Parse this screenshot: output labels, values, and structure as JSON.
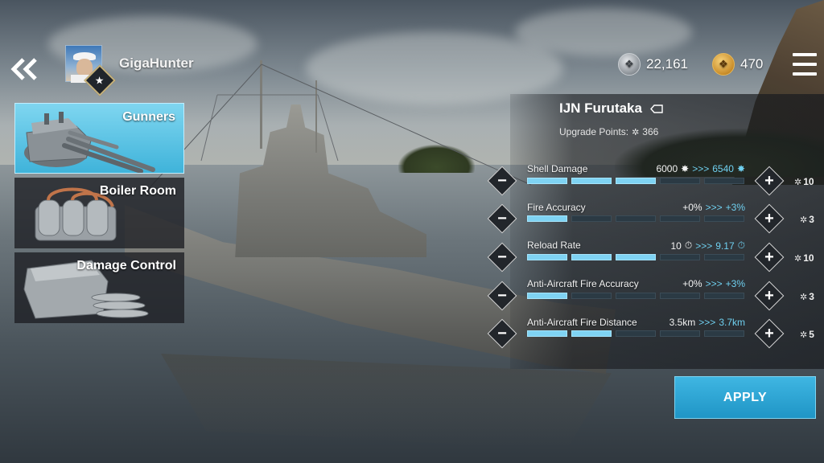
{
  "header": {
    "player_name": "GigaHunter",
    "rank_icon": "star-icon",
    "silver_amount": "22,161",
    "gold_amount": "470"
  },
  "categories": [
    {
      "label": "Gunners",
      "icon": "gun-turret-icon",
      "active": true
    },
    {
      "label": "Boiler Room",
      "icon": "boiler-icon",
      "active": false
    },
    {
      "label": "Damage Control",
      "icon": "damage-control-icon",
      "active": false
    }
  ],
  "panel": {
    "ship_name": "IJN Furutaka",
    "upgrade_points_label": "Upgrade Points:",
    "upgrade_points_value": "366",
    "apply_label": "APPLY",
    "stats": [
      {
        "label": "Shell Damage",
        "current": "6000",
        "arrow": ">>>",
        "next": "6540",
        "filled": 3,
        "segments": 5,
        "cost": "10"
      },
      {
        "label": "Fire Accuracy",
        "current": "+0%",
        "arrow": ">>>",
        "next": "+3%",
        "filled": 1,
        "segments": 5,
        "cost": "3"
      },
      {
        "label": "Reload Rate",
        "current": "10",
        "arrow": ">>>",
        "next": "9.17",
        "filled": 3,
        "segments": 5,
        "cost": "10"
      },
      {
        "label": "Anti-Aircraft Fire Accuracy",
        "current": "+0%",
        "arrow": ">>>",
        "next": "+3%",
        "filled": 1,
        "segments": 5,
        "cost": "3"
      },
      {
        "label": "Anti-Aircraft Fire Distance",
        "current": "3.5km",
        "arrow": ">>>",
        "next": "3.7km",
        "filled": 2,
        "segments": 5,
        "cost": "5"
      }
    ]
  },
  "colors": {
    "accent": "#3fb6e2",
    "bar_on": "#7fd3f3",
    "bar_off": "#2b3a44",
    "value_highlight": "#6fd0f0"
  }
}
